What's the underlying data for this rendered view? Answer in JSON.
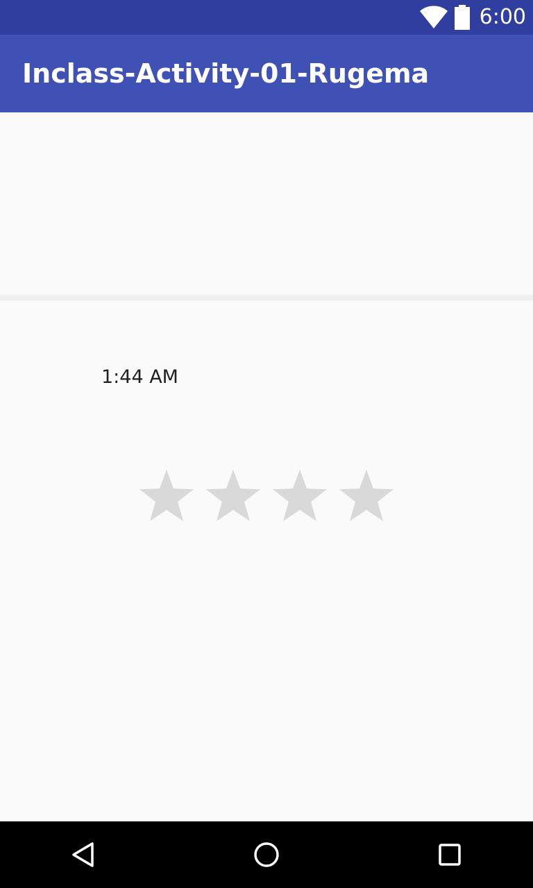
{
  "status_bar": {
    "time": "6:00",
    "icons": [
      "wifi-icon",
      "battery-icon"
    ],
    "background": "#303f9f"
  },
  "app_bar": {
    "title": "Inclass-Activity-01-Rugema",
    "background": "#3f51b5"
  },
  "content": {
    "time_text": "1:44 AM",
    "rating": {
      "num_stars": 4,
      "value": 0,
      "empty_color": "#d9d9d9",
      "filled_color": "#ff4081"
    }
  },
  "nav_bar": {
    "buttons": [
      "back-icon",
      "home-icon",
      "recents-icon"
    ]
  }
}
